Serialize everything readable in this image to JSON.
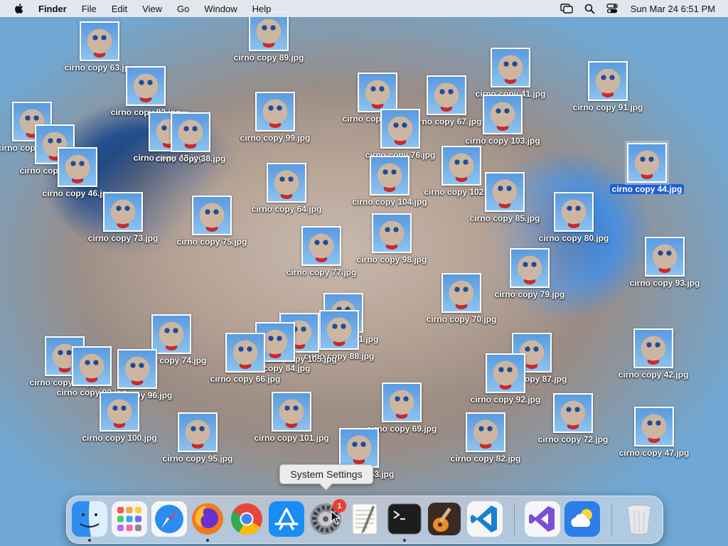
{
  "menubar": {
    "app": "Finder",
    "menus": [
      "File",
      "Edit",
      "View",
      "Go",
      "Window",
      "Help"
    ],
    "clock": "Sun Mar 24  6:51 PM"
  },
  "desktop": {
    "files": [
      {
        "label": "cirno copy 89.jpg"
      },
      {
        "label": "cirno copy 63.jpg"
      },
      {
        "label": "cirno copy 83.jpg"
      },
      {
        "label": "cirno copy 43.jpg"
      },
      {
        "label": "cirno copy 38.jpg"
      },
      {
        "label": "cirno copy 62.jpg"
      },
      {
        "label": "cirno copy 61.jpg"
      },
      {
        "label": "cirno copy 46.jpg"
      },
      {
        "label": "cirno copy 73.jpg"
      },
      {
        "label": "cirno copy 99.jpg"
      },
      {
        "label": "cirno copy 75.jpg"
      },
      {
        "label": "cirno copy 64.jpg"
      },
      {
        "label": "cirno copy 86.jpg"
      },
      {
        "label": "cirno copy 67.jpg"
      },
      {
        "label": "cirno copy 41.jpg"
      },
      {
        "label": "cirno copy 91.jpg"
      },
      {
        "label": "cirno copy 103.jpg"
      },
      {
        "label": "cirno copy 76.jpg"
      },
      {
        "label": "cirno copy 104.jpg"
      },
      {
        "label": "cirno copy 102.jpg"
      },
      {
        "label": "cirno copy 85.jpg"
      },
      {
        "label": "cirno copy 44.jpg"
      },
      {
        "label": "cirno copy 80.jpg"
      },
      {
        "label": "cirno copy 77.jpg"
      },
      {
        "label": "cirno copy 98.jpg"
      },
      {
        "label": "cirno copy 79.jpg"
      },
      {
        "label": "cirno copy 93.jpg"
      },
      {
        "label": "cirno copy 71.jpg"
      },
      {
        "label": "cirno copy 88.jpg"
      },
      {
        "label": "cirno copy 105.jpg"
      },
      {
        "label": "cirno copy 84.jpg"
      },
      {
        "label": "cirno copy 66.jpg"
      },
      {
        "label": "cirno copy 74.jpg"
      },
      {
        "label": "cirno copy 65.jpg"
      },
      {
        "label": "cirno copy 90.jpg"
      },
      {
        "label": "cirno copy 96.jpg"
      },
      {
        "label": "cirno copy 100.jpg"
      },
      {
        "label": "cirno copy 95.jpg"
      },
      {
        "label": "cirno copy 101.jpg"
      },
      {
        "label": "cirno copy 69.jpg"
      },
      {
        "label": "cirno copy 87.jpg"
      },
      {
        "label": "cirno copy 92.jpg"
      },
      {
        "label": "cirno copy 82.jpg"
      },
      {
        "label": "cirno copy 72.jpg"
      },
      {
        "label": "cirno copy 42.jpg"
      },
      {
        "label": "cirno copy 47.jpg"
      },
      {
        "label": "cirno copy 53.jpg"
      },
      {
        "label": "cirno copy 70.jpg"
      }
    ],
    "selected": "cirno copy 44.jpg"
  },
  "tooltip": {
    "text": "System Settings"
  },
  "dock": {
    "items": [
      "finder-icon",
      "launchpad-icon",
      "safari-icon",
      "firefox-icon",
      "chrome-icon",
      "app-store-icon",
      "system-settings-icon",
      "textedit-icon",
      "terminal-icon",
      "garageband-icon",
      "vscode-icon",
      "visual-studio-icon",
      "weather-icon",
      "trash-icon"
    ],
    "settings_badge": "1"
  },
  "colors": {
    "selection": "#1f5fd6",
    "badge": "#f23b30"
  }
}
